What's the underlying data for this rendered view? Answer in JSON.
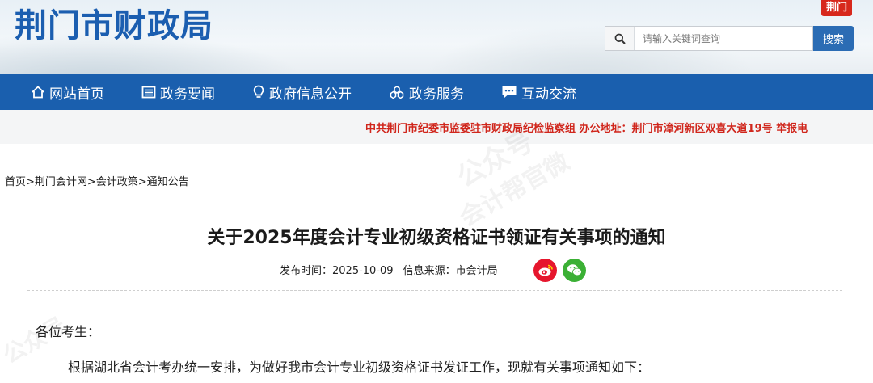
{
  "header": {
    "site_title": "荆门市财政局",
    "corner_logo": "荆门",
    "search": {
      "placeholder": "请输入关键词查询",
      "button_label": "搜索"
    }
  },
  "nav": {
    "items": [
      {
        "label": "网站首页",
        "icon": "home-icon"
      },
      {
        "label": "政务要闻",
        "icon": "news-icon"
      },
      {
        "label": "政府信息公开",
        "icon": "bulb-icon"
      },
      {
        "label": "政务服务",
        "icon": "service-icon"
      },
      {
        "label": "互动交流",
        "icon": "chat-icon"
      }
    ]
  },
  "ticker": {
    "text": "中共荆门市纪委市监委驻市财政局纪检监察组 办公地址：荆门市漳河新区双喜大道19号 举报电"
  },
  "breadcrumb": "首页>荆门会计网>会计政策>通知公告",
  "article": {
    "title": "关于2025年度会计专业初级资格证书领证有关事项的通知",
    "publish_time": "发布时间：2025-10-09",
    "source": "信息来源：市会计局",
    "salutation": "各位考生：",
    "paragraph": "根据湖北省会计考办统一安排，为做好我市会计专业初级资格证书发证工作，现就有关事项通知如下："
  },
  "watermark": {
    "text1": "公众号",
    "text2": "会计帮官微"
  },
  "colors": {
    "brand_blue": "#1a5fae",
    "title_blue": "#1b5eb0",
    "ticker_red": "#d0261c",
    "weibo_red": "#e6162d",
    "wechat_green": "#3bb035"
  }
}
